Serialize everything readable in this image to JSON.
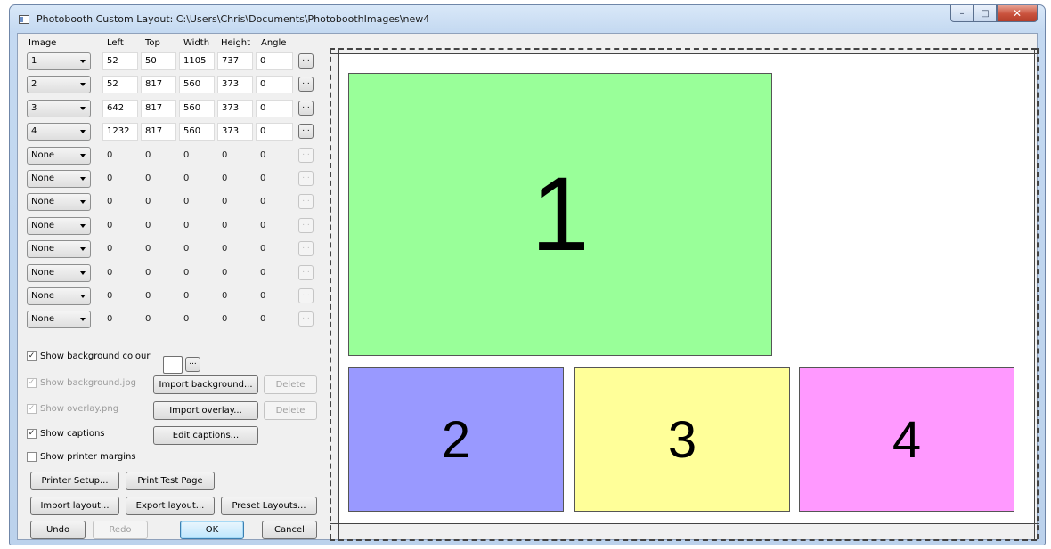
{
  "window": {
    "title": "Photobooth Custom Layout: C:\\Users\\Chris\\Documents\\PhotoboothImages\\new4",
    "minimize": "–",
    "maximize": "□",
    "close": "✕"
  },
  "headers": {
    "image": "Image",
    "left": "Left",
    "top": "Top",
    "width": "Width",
    "height": "Height",
    "angle": "Angle"
  },
  "rows": [
    {
      "image": "1",
      "left": "52",
      "top": "50",
      "width": "1105",
      "height": "737",
      "angle": "0",
      "more": "..."
    },
    {
      "image": "2",
      "left": "52",
      "top": "817",
      "width": "560",
      "height": "373",
      "angle": "0",
      "more": "..."
    },
    {
      "image": "3",
      "left": "642",
      "top": "817",
      "width": "560",
      "height": "373",
      "angle": "0",
      "more": "..."
    },
    {
      "image": "4",
      "left": "1232",
      "top": "817",
      "width": "560",
      "height": "373",
      "angle": "0",
      "more": "..."
    },
    {
      "image": "None",
      "left": "0",
      "top": "0",
      "width": "0",
      "height": "0",
      "angle": "0",
      "more": "..."
    },
    {
      "image": "None",
      "left": "0",
      "top": "0",
      "width": "0",
      "height": "0",
      "angle": "0",
      "more": "..."
    },
    {
      "image": "None",
      "left": "0",
      "top": "0",
      "width": "0",
      "height": "0",
      "angle": "0",
      "more": "..."
    },
    {
      "image": "None",
      "left": "0",
      "top": "0",
      "width": "0",
      "height": "0",
      "angle": "0",
      "more": "..."
    },
    {
      "image": "None",
      "left": "0",
      "top": "0",
      "width": "0",
      "height": "0",
      "angle": "0",
      "more": "..."
    },
    {
      "image": "None",
      "left": "0",
      "top": "0",
      "width": "0",
      "height": "0",
      "angle": "0",
      "more": "..."
    },
    {
      "image": "None",
      "left": "0",
      "top": "0",
      "width": "0",
      "height": "0",
      "angle": "0",
      "more": "..."
    },
    {
      "image": "None",
      "left": "0",
      "top": "0",
      "width": "0",
      "height": "0",
      "angle": "0",
      "more": "..."
    }
  ],
  "options": {
    "show_background_colour": {
      "label": "Show background colour",
      "checked": true,
      "more": "..."
    },
    "show_background_jpg": {
      "label": "Show background.jpg",
      "checked": true,
      "enabled": false
    },
    "show_overlay_png": {
      "label": "Show overlay.png",
      "checked": true,
      "enabled": false
    },
    "show_captions": {
      "label": "Show captions",
      "checked": true
    },
    "show_printer_margins": {
      "label": "Show printer margins",
      "checked": false
    }
  },
  "buttons": {
    "import_background": "Import background...",
    "delete_background": "Delete",
    "import_overlay": "Import overlay...",
    "delete_overlay": "Delete",
    "edit_captions": "Edit captions...",
    "printer_setup": "Printer Setup...",
    "print_test_page": "Print Test Page",
    "import_layout": "Import layout...",
    "export_layout": "Export layout...",
    "preset_layouts": "Preset Layouts...",
    "undo": "Undo",
    "redo": "Redo",
    "ok": "OK",
    "cancel": "Cancel"
  },
  "check_mark": "✓",
  "preview": {
    "slots": [
      {
        "label": "1",
        "color": "#99ff99"
      },
      {
        "label": "2",
        "color": "#9999ff"
      },
      {
        "label": "3",
        "color": "#ffff99"
      },
      {
        "label": "4",
        "color": "#ff99ff"
      }
    ]
  }
}
